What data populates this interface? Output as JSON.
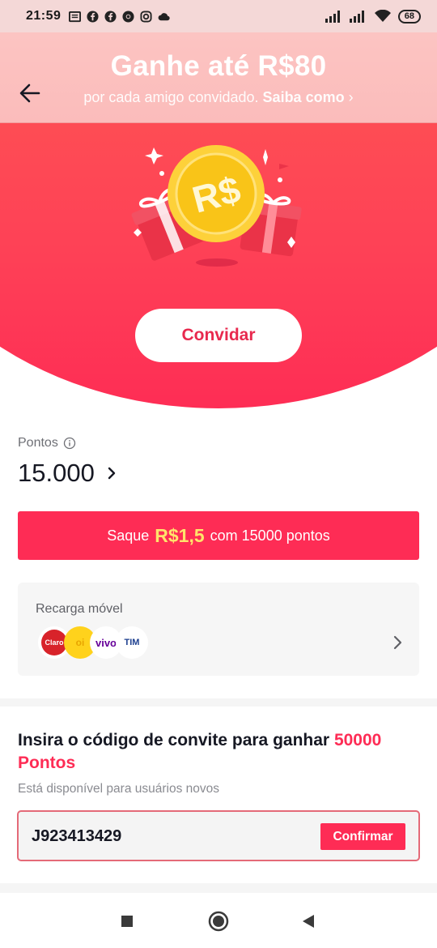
{
  "status_bar": {
    "time": "21:59",
    "icons": [
      "news-icon",
      "facebook-icon",
      "facebook-icon",
      "chrome-icon",
      "instagram-icon",
      "cloud-icon"
    ],
    "battery": "68"
  },
  "header": {
    "title": "Ganhe até R$80",
    "subtitle_text": "por cada amigo convidado.",
    "subtitle_link": "Saiba como"
  },
  "hero": {
    "invite_label": "Convidar"
  },
  "points": {
    "label": "Pontos",
    "value": "15.000"
  },
  "cashout": {
    "prefix": "Saque",
    "amount": "R$1,5",
    "suffix": "com 15000 pontos"
  },
  "recharge": {
    "label": "Recarga móvel",
    "carriers": [
      "Claro",
      "oi",
      "vivo",
      "TIM"
    ]
  },
  "invite_code": {
    "title_text": "Insira o código de convite para ganhar",
    "title_highlight": "50000 Pontos",
    "subtitle": "Está disponível para usuários novos",
    "input_value": "J923413429",
    "confirm_label": "Confirmar"
  },
  "colors": {
    "accent": "#fe2c55",
    "highlight": "#ffe46b",
    "hero_top": "#fe6251"
  }
}
